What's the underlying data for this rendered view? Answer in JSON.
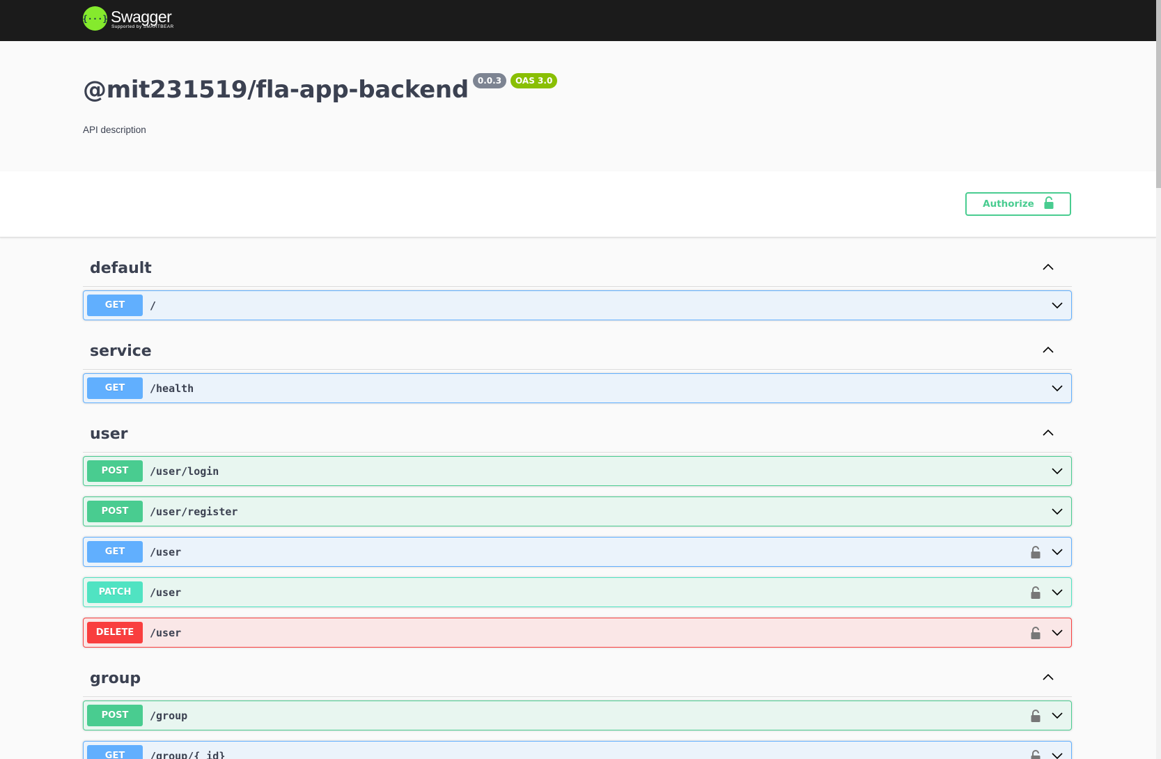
{
  "topbar": {
    "logo_name": "Swagger",
    "logo_sub": "Supported by SMARTBEAR",
    "logo_glyph": "{···}"
  },
  "info": {
    "title": "@mit231519/fla-app-backend",
    "version": "0.0.3",
    "oas": "OAS 3.0",
    "description": "API description"
  },
  "authorize": {
    "label": "Authorize"
  },
  "colors": {
    "get": "#61affe",
    "post": "#49cc90",
    "patch": "#50e3c2",
    "delete": "#f93e3e",
    "accent": "#85ea2d"
  },
  "tags": [
    {
      "name": "default",
      "operations": [
        {
          "method": "GET",
          "path": "/",
          "locked": false
        }
      ]
    },
    {
      "name": "service",
      "operations": [
        {
          "method": "GET",
          "path": "/health",
          "locked": false
        }
      ]
    },
    {
      "name": "user",
      "operations": [
        {
          "method": "POST",
          "path": "/user/login",
          "locked": false
        },
        {
          "method": "POST",
          "path": "/user/register",
          "locked": false
        },
        {
          "method": "GET",
          "path": "/user",
          "locked": true
        },
        {
          "method": "PATCH",
          "path": "/user",
          "locked": true
        },
        {
          "method": "DELETE",
          "path": "/user",
          "locked": true
        }
      ]
    },
    {
      "name": "group",
      "operations": [
        {
          "method": "POST",
          "path": "/group",
          "locked": true
        },
        {
          "method": "GET",
          "path": "/group/{_id}",
          "locked": true
        }
      ]
    }
  ]
}
